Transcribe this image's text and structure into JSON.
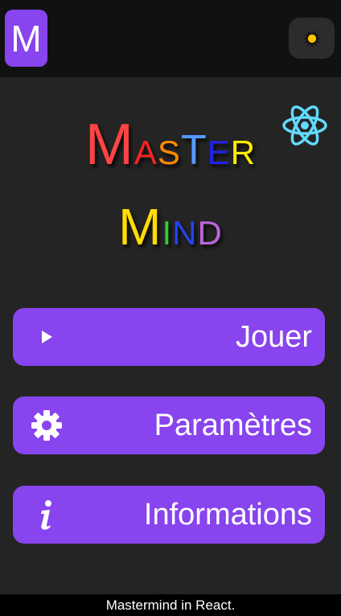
{
  "header": {
    "logo_letter": "M",
    "theme_toggle_icon": "sun-icon"
  },
  "title": {
    "line1": [
      {
        "text": "M",
        "size": "big",
        "color": "#ff4444"
      },
      {
        "text": "A",
        "size": "sm",
        "color": "#ff2222"
      },
      {
        "text": "S",
        "size": "sm",
        "color": "#ff8800"
      },
      {
        "text": "T",
        "size": "big-mid",
        "color": "#5599ff"
      },
      {
        "text": "E",
        "size": "sm",
        "color": "#2222ee"
      },
      {
        "text": "R",
        "size": "sm",
        "color": "#ffee00"
      }
    ],
    "line2": [
      {
        "text": "M",
        "size": "big",
        "color": "#ffdd00"
      },
      {
        "text": "I",
        "size": "sm",
        "color": "#33cc33"
      },
      {
        "text": "N",
        "size": "sm",
        "color": "#2244ee"
      },
      {
        "text": "D",
        "size": "sm",
        "color": "#bb66dd"
      }
    ]
  },
  "menu": {
    "play_label": "Jouer",
    "settings_label": "Paramètres",
    "info_label": "Informations"
  },
  "footer": {
    "text": "Mastermind in React."
  },
  "colors": {
    "accent": "#8844ee",
    "background": "#242424",
    "topbar": "#111111"
  }
}
